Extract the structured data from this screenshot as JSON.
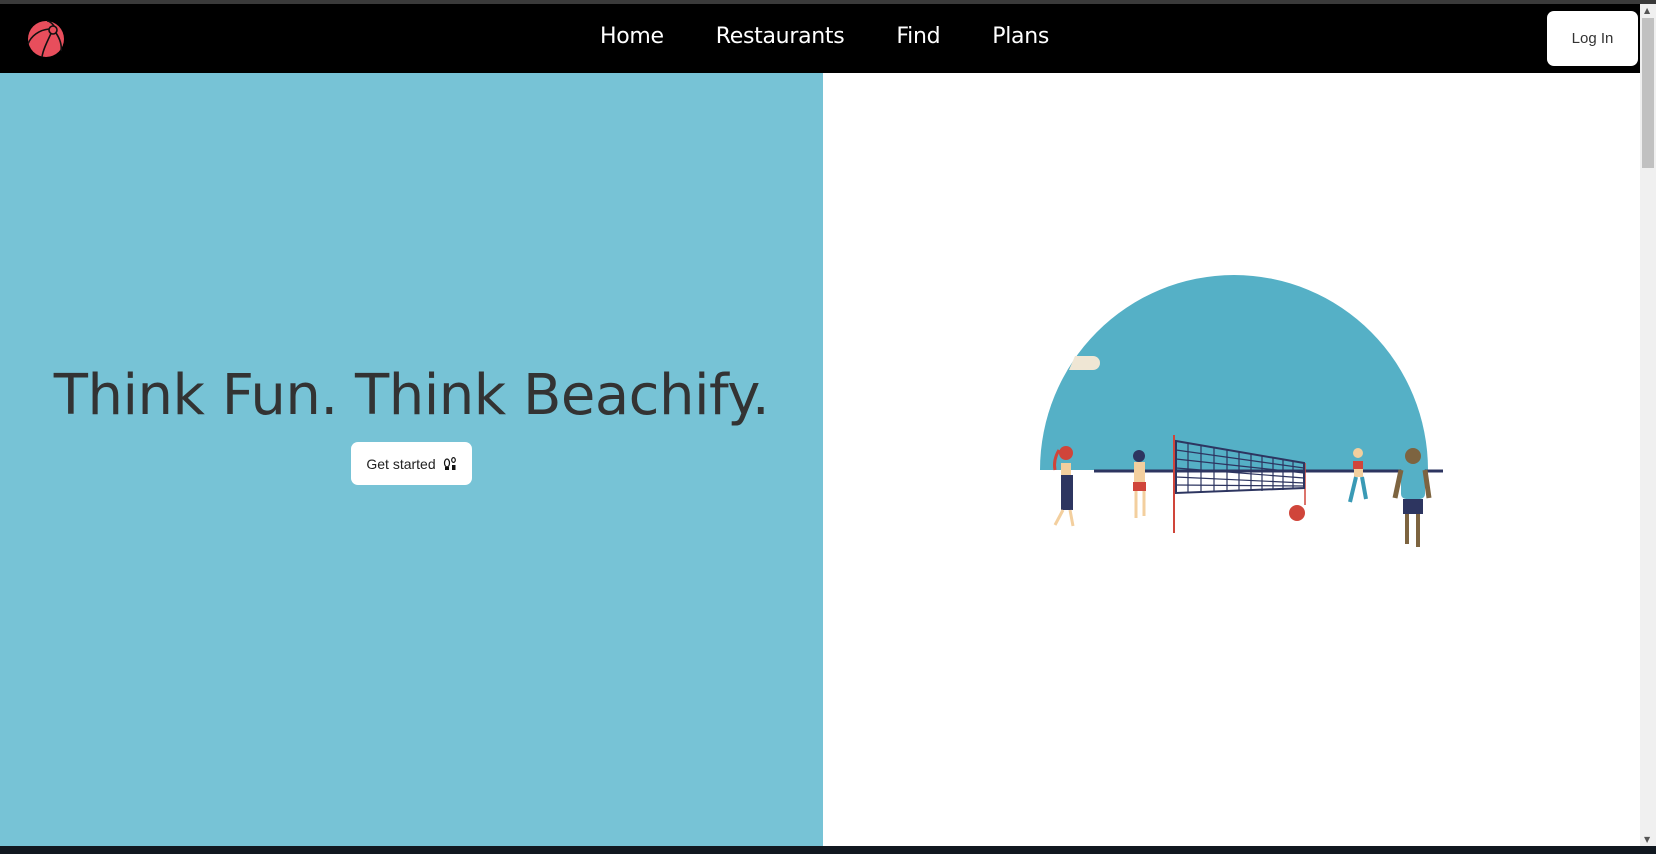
{
  "nav": {
    "links": [
      "Home",
      "Restaurants",
      "Find",
      "Plans"
    ],
    "login_label": "Log In",
    "logo_icon": "beach-ball-icon"
  },
  "hero": {
    "headline": "Think Fun. Think Beachify.",
    "cta_label": "Get started",
    "cta_icon": "footprints-icon"
  },
  "colors": {
    "hero_bg": "#77c3d6",
    "logo": "#e84e5c",
    "sky": "#55b0c6"
  }
}
